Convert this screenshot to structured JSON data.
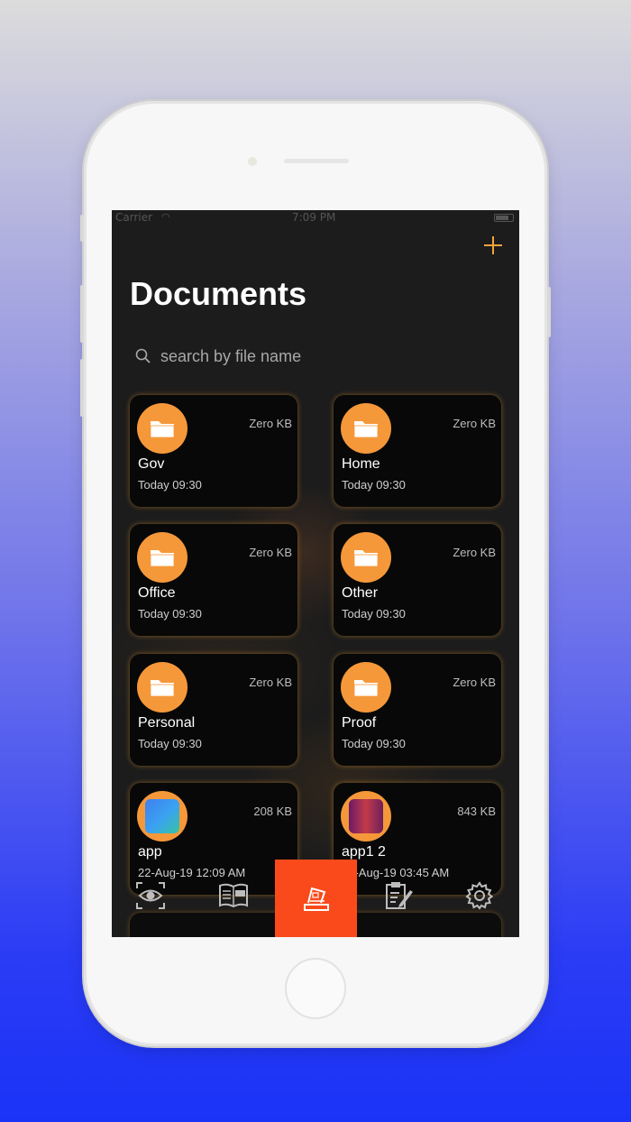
{
  "status_bar": {
    "carrier": "Carrier",
    "time": "7:09 PM"
  },
  "header": {
    "title": "Documents",
    "add_icon": "plus-icon"
  },
  "search": {
    "placeholder": "search by file name"
  },
  "colors": {
    "accent": "#f7a23b",
    "folder": "#f5983a",
    "tab_active": "#fa4a1c"
  },
  "items": [
    {
      "name": "Gov",
      "size": "Zero KB",
      "date": "Today 09:30",
      "icon": "folder-icon"
    },
    {
      "name": "Home",
      "size": "Zero KB",
      "date": "Today 09:30",
      "icon": "folder-icon"
    },
    {
      "name": "Office",
      "size": "Zero KB",
      "date": "Today 09:30",
      "icon": "folder-icon"
    },
    {
      "name": "Other",
      "size": "Zero KB",
      "date": "Today 09:30",
      "icon": "folder-icon"
    },
    {
      "name": "Personal",
      "size": "Zero KB",
      "date": "Today 09:30",
      "icon": "folder-icon"
    },
    {
      "name": "Proof",
      "size": "Zero KB",
      "date": "Today 09:30",
      "icon": "folder-icon"
    },
    {
      "name": "app",
      "size": "208 KB",
      "date": "22-Aug-19 12:09 AM",
      "icon": "image-thumbnail"
    },
    {
      "name": "app1 2",
      "size": "843 KB",
      "date": "22-Aug-19 03:45 AM",
      "icon": "image-thumbnail"
    }
  ],
  "tabs": [
    {
      "icon": "eye-scan-icon"
    },
    {
      "icon": "pdf-book-icon"
    },
    {
      "icon": "scanner-icon",
      "active": true
    },
    {
      "icon": "clipboard-edit-icon"
    },
    {
      "icon": "gear-icon"
    }
  ]
}
